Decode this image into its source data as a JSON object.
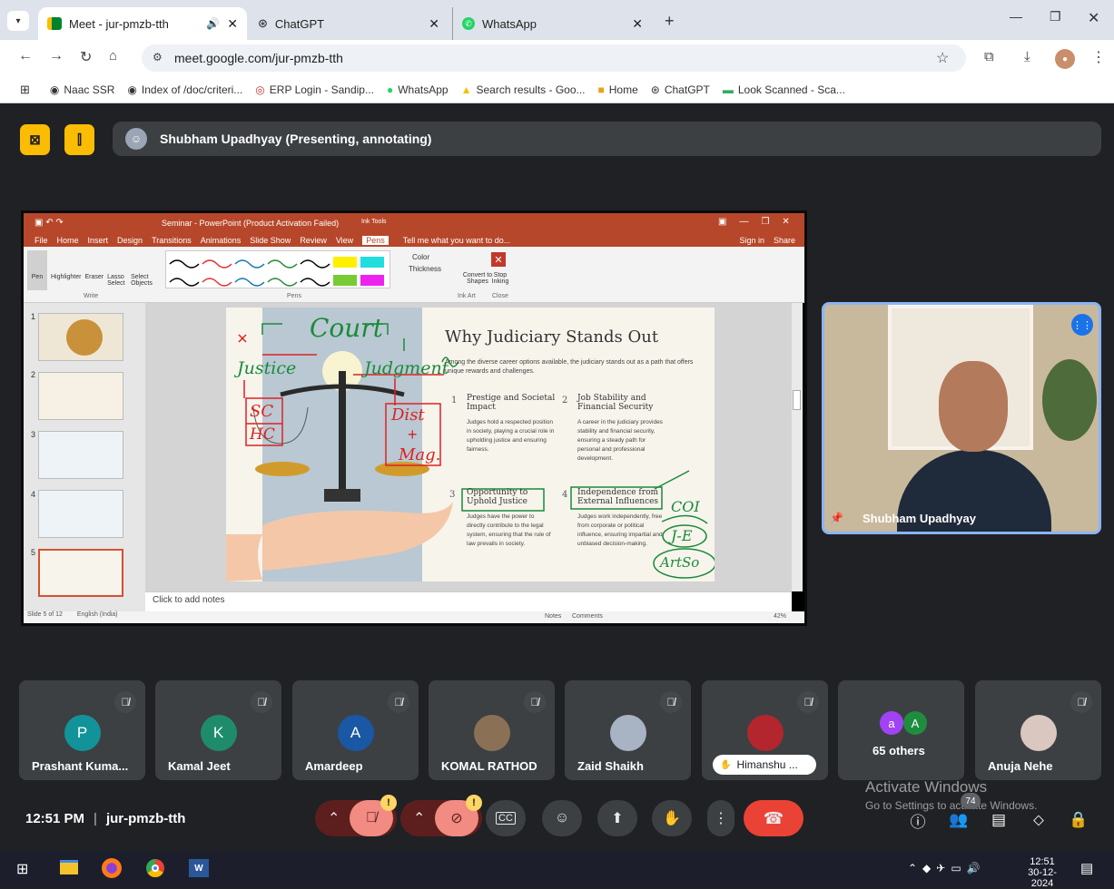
{
  "browser": {
    "tabs": [
      {
        "title": "Meet - jur-pmzb-tth",
        "active": true
      },
      {
        "title": "ChatGPT",
        "active": false
      },
      {
        "title": "WhatsApp",
        "active": false
      }
    ],
    "url": "meet.google.com/jur-pmzb-tth",
    "bookmarks": [
      "Naac SSR",
      "Index of /doc/criteri...",
      "ERP Login - Sandip...",
      "WhatsApp",
      "Search results - Goo...",
      "Home",
      "ChatGPT",
      "Look Scanned - Sca..."
    ]
  },
  "meet": {
    "presenter_banner": "Shubham Upadhyay (Presenting, annotating)",
    "self_video_name": "Shubham Upadhyay",
    "time": "12:51 PM",
    "separator": "|",
    "meeting_code": "jur-pmzb-tth",
    "participant_count": "74",
    "participants": [
      {
        "name": "Prashant Kuma...",
        "initial": "P",
        "color": "#12939a"
      },
      {
        "name": "Kamal Jeet",
        "initial": "K",
        "color": "#1e8c6b"
      },
      {
        "name": "Amardeep",
        "initial": "A",
        "color": "#1a57a4"
      },
      {
        "name": "KOMAL RATHOD",
        "initial": "",
        "color": "#8a7155"
      },
      {
        "name": "Zaid Shaikh",
        "initial": "",
        "color": "#a8b4c4"
      },
      {
        "name": "Himanshu ...",
        "initial": "",
        "color": "#b3262d"
      },
      {
        "name": "65 others",
        "initial": "",
        "color": ""
      },
      {
        "name": "Anuja Nehe",
        "initial": "",
        "color": "#d9c7c0"
      }
    ],
    "others_avatars": [
      "a",
      "A"
    ]
  },
  "ppt": {
    "title": "Seminar - PowerPoint (Product Activation Failed)",
    "context_tab": "Ink Tools",
    "menu": [
      "File",
      "Home",
      "Insert",
      "Design",
      "Transitions",
      "Animations",
      "Slide Show",
      "Review",
      "View",
      "Pens"
    ],
    "tell_me": "Tell me what you want to do...",
    "sign_in": "Sign in",
    "share": "Share",
    "tools": [
      "Pen",
      "Highlighter",
      "Eraser",
      "Lasso Select",
      "Select Objects"
    ],
    "group_write": "Write",
    "group_pens": "Pens",
    "color": "Color",
    "thickness": "Thickness",
    "convert": "Convert to Shapes",
    "stop": "Stop Inking",
    "group_inkart": "Ink Art",
    "group_close": "Close",
    "notes_placeholder": "Click to add notes",
    "status_slide": "Slide 5 of 12",
    "status_lang": "English (India)",
    "status_notes": "Notes",
    "status_comments": "Comments",
    "zoom": "42%",
    "thumb_numbers": [
      "1",
      "2",
      "3",
      "4",
      "5"
    ],
    "slide": {
      "heading": "Why Judiciary Stands Out",
      "intro": "Among the diverse career options available, the judiciary stands out as a path that offers unique rewards and challenges.",
      "items": [
        {
          "num": "1",
          "title": "Prestige and Societal Impact",
          "body": "Judges hold a respected position in society, playing a crucial role in upholding justice and ensuring fairness."
        },
        {
          "num": "2",
          "title": "Job Stability and Financial Security",
          "body": "A career in the judiciary provides stability and financial security, ensuring a steady path for personal and professional development."
        },
        {
          "num": "3",
          "title": "Opportunity to Uphold Justice",
          "body": "Judges have the power to directly contribute to the legal system, ensuring that the rule of law prevails in society."
        },
        {
          "num": "4",
          "title": "Independence from External Influences",
          "body": "Judges work independently, free from corporate or political influence, ensuring impartial and unbiased decision-making."
        }
      ],
      "annotations": [
        "Court",
        "Justice",
        "Judgment",
        "SC",
        "HC",
        "Dist",
        "+",
        "Mag.",
        "COI",
        "J-E",
        "ArtSo"
      ]
    }
  },
  "watermark": {
    "line1": "Activate Windows",
    "line2": "Go to Settings to activate Windows."
  },
  "taskbar": {
    "time": "12:51",
    "date": "30-12-2024"
  },
  "colors": {
    "end_call": "#ea4335",
    "ppt_red": "#b7472a",
    "accent": "#8ab4f8",
    "warn": "#fdd663"
  }
}
